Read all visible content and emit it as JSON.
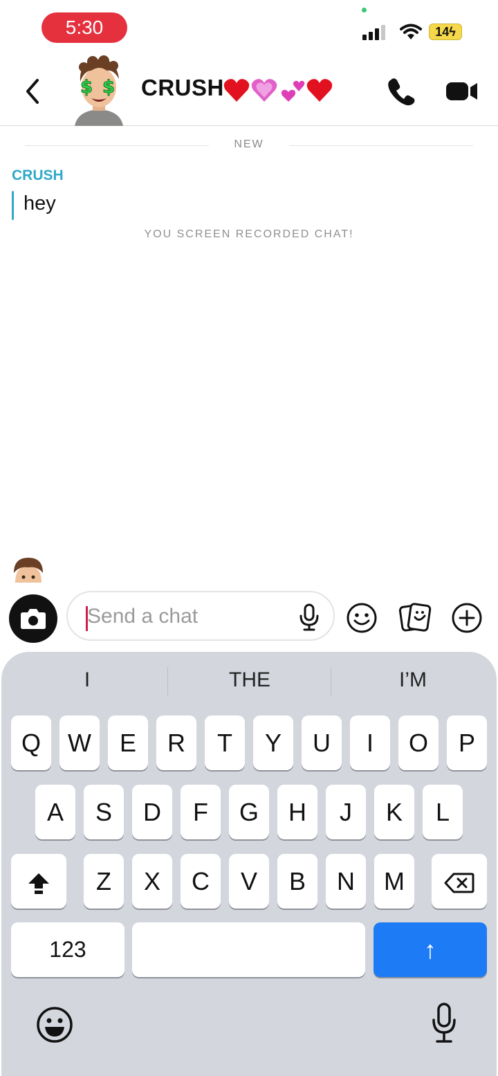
{
  "status_bar": {
    "time": "5:30",
    "battery": "14",
    "icons": [
      "signal-icon",
      "wifi-icon",
      "battery-icon"
    ]
  },
  "header": {
    "title": "CRUSH",
    "title_emoji": "❤️💗💕❤️",
    "icons": [
      "back-icon",
      "avatar",
      "call-icon",
      "video-call-icon"
    ]
  },
  "messages": {
    "divider_label": "NEW",
    "sender": "CRUSH",
    "text": "hey",
    "system_note": "YOU SCREEN RECORDED CHAT!"
  },
  "composer": {
    "placeholder": "Send a chat",
    "icons": [
      "camera-icon",
      "mic-icon",
      "emoji-icon",
      "sticker-icon",
      "plus-icon"
    ]
  },
  "keyboard": {
    "suggestions": [
      "I",
      "THE",
      "I’M"
    ],
    "row1": [
      "Q",
      "W",
      "E",
      "R",
      "T",
      "Y",
      "U",
      "I",
      "O",
      "P"
    ],
    "row2": [
      "A",
      "S",
      "D",
      "F",
      "G",
      "H",
      "J",
      "K",
      "L"
    ],
    "row3": [
      "Z",
      "X",
      "C",
      "V",
      "B",
      "N",
      "M"
    ],
    "numbers_key": "123",
    "return_key": "↑",
    "icons": [
      "shift-icon",
      "backspace-icon",
      "keyboard-emoji-icon",
      "dictation-mic-icon"
    ]
  },
  "colors": {
    "time_pill": "#e5303e",
    "sender_accent": "#2fa8c9",
    "send_key": "#1d7bf6",
    "caret": "#d21d48"
  }
}
